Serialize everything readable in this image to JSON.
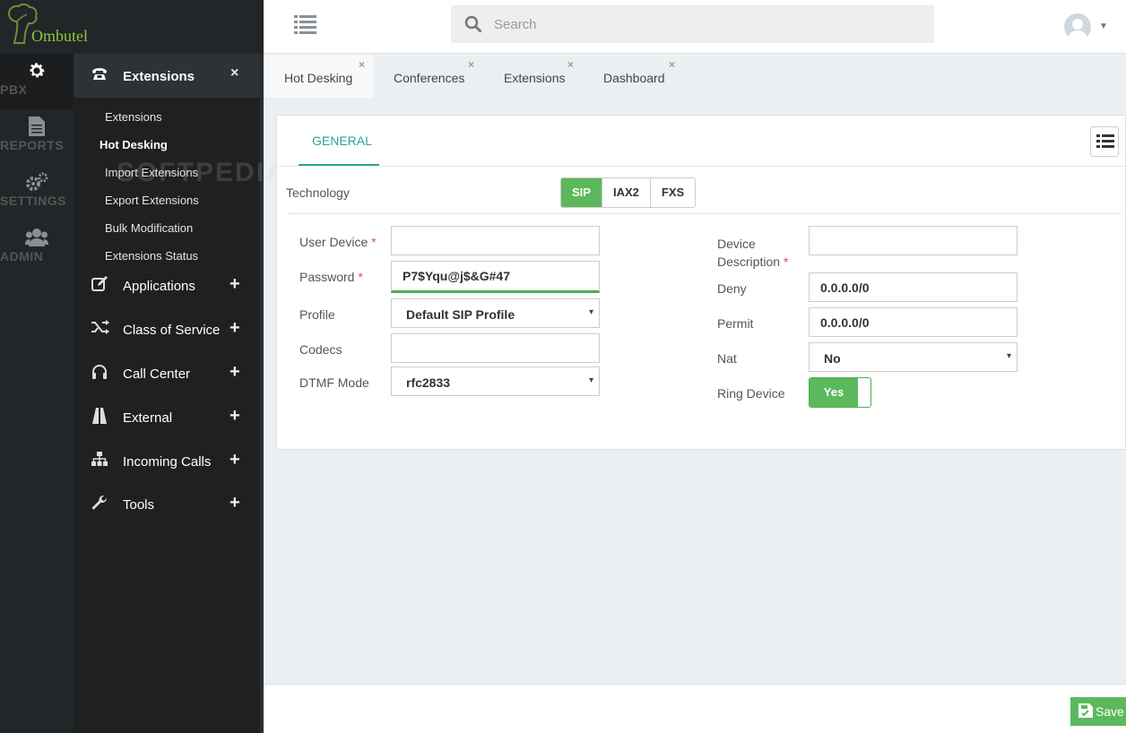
{
  "brand": {
    "name": "Ombutel"
  },
  "rail": {
    "items": [
      {
        "label": "PBX",
        "icon": "gear-icon"
      },
      {
        "label": "REPORTS",
        "icon": "document-icon"
      },
      {
        "label": "SETTINGS",
        "icon": "gears-icon"
      },
      {
        "label": "ADMIN",
        "icon": "users-icon"
      }
    ]
  },
  "sidebar": {
    "header": {
      "label": "Extensions",
      "close": "×"
    },
    "sub_items": [
      "Extensions",
      "Hot Desking",
      "Import Extensions",
      "Export Extensions",
      "Bulk Modification",
      "Extensions Status"
    ],
    "menus": [
      "Applications",
      "Class of Service",
      "Call Center",
      "External",
      "Incoming Calls",
      "Tools"
    ],
    "plus": "+",
    "watermark": "SOFTPEDIA"
  },
  "search": {
    "placeholder": "Search"
  },
  "tabs": [
    {
      "label": "Hot Desking",
      "close": "×"
    },
    {
      "label": "Conferences",
      "close": "×"
    },
    {
      "label": "Extensions",
      "close": "×"
    },
    {
      "label": "Dashboard",
      "close": "×"
    }
  ],
  "panel": {
    "tab": "GENERAL",
    "technology": {
      "label": "Technology",
      "options": [
        "SIP",
        "IAX2",
        "FXS"
      ],
      "selected": "SIP"
    },
    "left": {
      "user_device": {
        "label": "User Device",
        "value": ""
      },
      "password": {
        "label": "Password",
        "value": "P7$Yqu@j$&G#47"
      },
      "profile": {
        "label": "Profile",
        "value": "Default SIP Profile"
      },
      "codecs": {
        "label": "Codecs",
        "value": ""
      },
      "dtmf": {
        "label": "DTMF Mode",
        "value": "rfc2833"
      }
    },
    "right": {
      "device_description": {
        "label_line1": "Device",
        "label_line2": "Description",
        "value": ""
      },
      "deny": {
        "label": "Deny",
        "value": "0.0.0.0/0"
      },
      "permit": {
        "label": "Permit",
        "value": "0.0.0.0/0"
      },
      "nat": {
        "label": "Nat",
        "value": "No"
      },
      "ring_device": {
        "label": "Ring Device",
        "value": "Yes"
      }
    },
    "required_mark": "*",
    "dropdown_arrow": "▾"
  },
  "footer": {
    "save_label": "Save"
  },
  "colors": {
    "accent": "#26a69a",
    "success": "#5cb85c",
    "sidebar": "#232628"
  }
}
